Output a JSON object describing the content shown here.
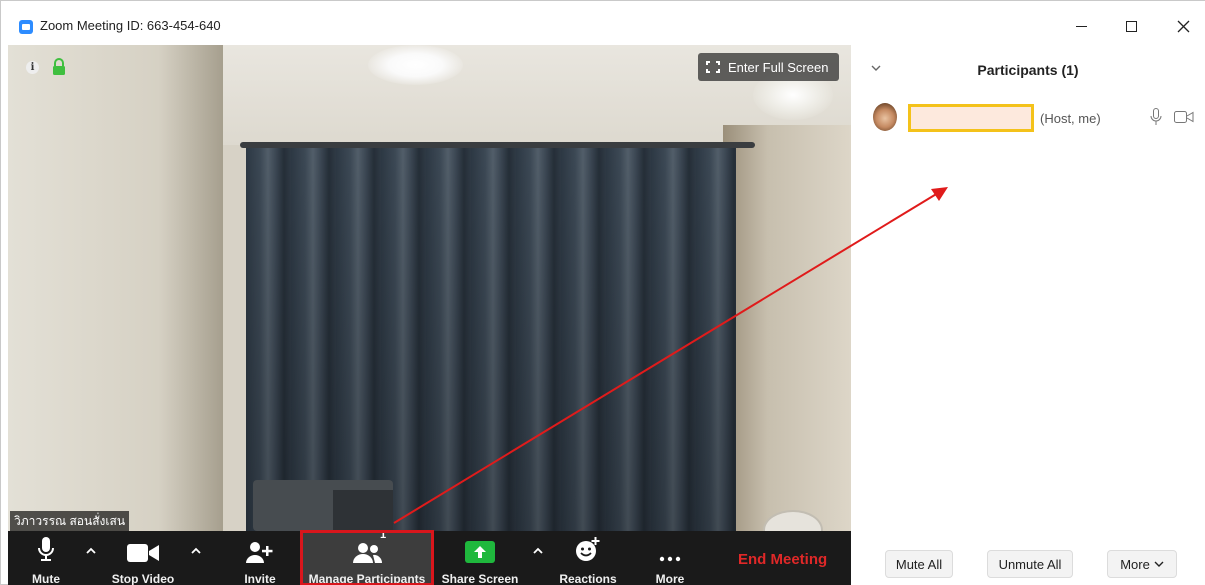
{
  "window": {
    "title": "Zoom Meeting ID: 663-454-640",
    "controls": {
      "minimize": "minimize",
      "maximize": "maximize",
      "close": "close"
    }
  },
  "video": {
    "fullscreen_label": "Enter Full Screen",
    "participant_name_label": "วิภาวรรณ สอนสั่งเสน"
  },
  "toolbar": {
    "mute_label": "Mute",
    "stop_video_label": "Stop Video",
    "invite_label": "Invite",
    "manage_participants_label": "Manage Participants",
    "participant_count": "1",
    "share_screen_label": "Share Screen",
    "reactions_label": "Reactions",
    "more_label": "More",
    "end_meeting_label": "End Meeting"
  },
  "panel": {
    "title": "Participants (1)",
    "participants": [
      {
        "name": "",
        "role": "(Host, me)"
      }
    ],
    "footer": {
      "mute_all_label": "Mute All",
      "unmute_all_label": "Unmute All",
      "more_label": "More"
    }
  },
  "colors": {
    "toolbar_bg": "#1a1a1a",
    "end_meeting": "#e02828",
    "share_screen": "#1fb83d",
    "highlight_red": "#d9161c",
    "highlight_yellow": "#f4c21a",
    "zoom_blue": "#2d8cff"
  },
  "icons": [
    "zoom-app-icon",
    "info-icon",
    "lock-icon",
    "fullscreen-icon",
    "microphone-icon",
    "camera-icon",
    "add-person-icon",
    "participants-icon",
    "share-screen-icon",
    "reactions-icon",
    "more-dots-icon",
    "chevron-up-icon",
    "chevron-down-icon"
  ]
}
